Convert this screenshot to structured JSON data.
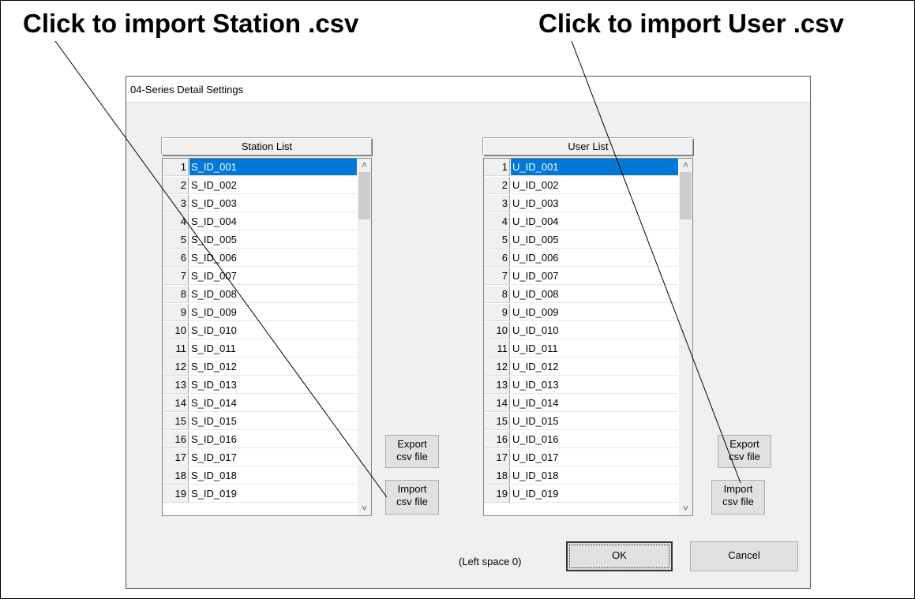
{
  "callouts": {
    "station": "Click to import Station .csv",
    "user": "Click to import User .csv"
  },
  "dialog": {
    "title": "04-Series Detail Settings",
    "station_list": {
      "header": "Station List",
      "selected_index": 0,
      "rows": [
        {
          "num": "1",
          "value": "S_ID_001"
        },
        {
          "num": "2",
          "value": "S_ID_002"
        },
        {
          "num": "3",
          "value": "S_ID_003"
        },
        {
          "num": "4",
          "value": "S_ID_004"
        },
        {
          "num": "5",
          "value": "S_ID_005"
        },
        {
          "num": "6",
          "value": "S_ID_006"
        },
        {
          "num": "7",
          "value": "S_ID_007"
        },
        {
          "num": "8",
          "value": "S_ID_008"
        },
        {
          "num": "9",
          "value": "S_ID_009"
        },
        {
          "num": "10",
          "value": "S_ID_010"
        },
        {
          "num": "11",
          "value": "S_ID_011"
        },
        {
          "num": "12",
          "value": "S_ID_012"
        },
        {
          "num": "13",
          "value": "S_ID_013"
        },
        {
          "num": "14",
          "value": "S_ID_014"
        },
        {
          "num": "15",
          "value": "S_ID_015"
        },
        {
          "num": "16",
          "value": "S_ID_016"
        },
        {
          "num": "17",
          "value": "S_ID_017"
        },
        {
          "num": "18",
          "value": "S_ID_018"
        },
        {
          "num": "19",
          "value": "S_ID_019"
        }
      ]
    },
    "user_list": {
      "header": "User List",
      "selected_index": 0,
      "rows": [
        {
          "num": "1",
          "value": "U_ID_001"
        },
        {
          "num": "2",
          "value": "U_ID_002"
        },
        {
          "num": "3",
          "value": "U_ID_003"
        },
        {
          "num": "4",
          "value": "U_ID_004"
        },
        {
          "num": "5",
          "value": "U_ID_005"
        },
        {
          "num": "6",
          "value": "U_ID_006"
        },
        {
          "num": "7",
          "value": "U_ID_007"
        },
        {
          "num": "8",
          "value": "U_ID_008"
        },
        {
          "num": "9",
          "value": "U_ID_009"
        },
        {
          "num": "10",
          "value": "U_ID_010"
        },
        {
          "num": "11",
          "value": "U_ID_011"
        },
        {
          "num": "12",
          "value": "U_ID_012"
        },
        {
          "num": "13",
          "value": "U_ID_013"
        },
        {
          "num": "14",
          "value": "U_ID_014"
        },
        {
          "num": "15",
          "value": "U_ID_015"
        },
        {
          "num": "16",
          "value": "U_ID_016"
        },
        {
          "num": "17",
          "value": "U_ID_017"
        },
        {
          "num": "18",
          "value": "U_ID_018"
        },
        {
          "num": "19",
          "value": "U_ID_019"
        }
      ]
    },
    "station_buttons": {
      "export_line1": "Export",
      "export_line2": "csv file",
      "import_line1": "Import",
      "import_line2": "csv file"
    },
    "user_buttons": {
      "export_line1": "Export",
      "export_line2": "csv file",
      "import_line1": "Import",
      "import_line2": "csv file"
    },
    "left_space": "(Left space 0)",
    "ok_label": "OK",
    "cancel_label": "Cancel",
    "scroll_up_icon": "chevron-up-icon",
    "scroll_down_icon": "chevron-down-icon",
    "selection_color": "#0078d7"
  }
}
